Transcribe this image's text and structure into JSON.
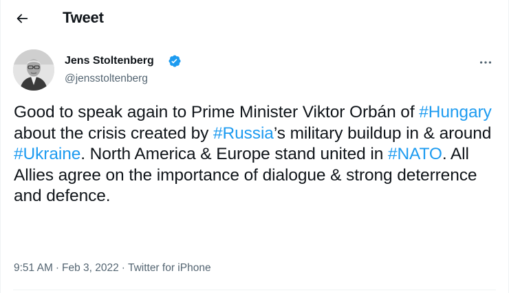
{
  "header": {
    "back_label": "Back",
    "title": "Tweet"
  },
  "author": {
    "name": "Jens Stoltenberg",
    "handle": "@jensstoltenberg",
    "verified": true,
    "avatar_icon": "profile-photo"
  },
  "tweet": {
    "segments": [
      {
        "text": "Good to speak again to Prime Minister Viktor Orbán of ",
        "type": "text"
      },
      {
        "text": "#Hungary",
        "type": "hashtag"
      },
      {
        "text": " about the crisis created by ",
        "type": "text"
      },
      {
        "text": "#Russia",
        "type": "hashtag"
      },
      {
        "text": "’s military buildup in & around ",
        "type": "text"
      },
      {
        "text": "#Ukraine",
        "type": "hashtag"
      },
      {
        "text": ". North America & Europe stand united in ",
        "type": "text"
      },
      {
        "text": "#NATO",
        "type": "hashtag"
      },
      {
        "text": ". All Allies agree on the importance of dialogue & strong deterrence and defence.",
        "type": "text"
      }
    ]
  },
  "meta": {
    "time": "9:51 AM",
    "date": "Feb 3, 2022",
    "source": "Twitter for iPhone",
    "separator": "·"
  },
  "colors": {
    "accent": "#1d9bf0",
    "text_primary": "#0f1419",
    "text_secondary": "#536471"
  },
  "icons": {
    "back": "arrow-left-icon",
    "verified": "verified-badge-icon",
    "more": "more-horizontal-icon"
  }
}
